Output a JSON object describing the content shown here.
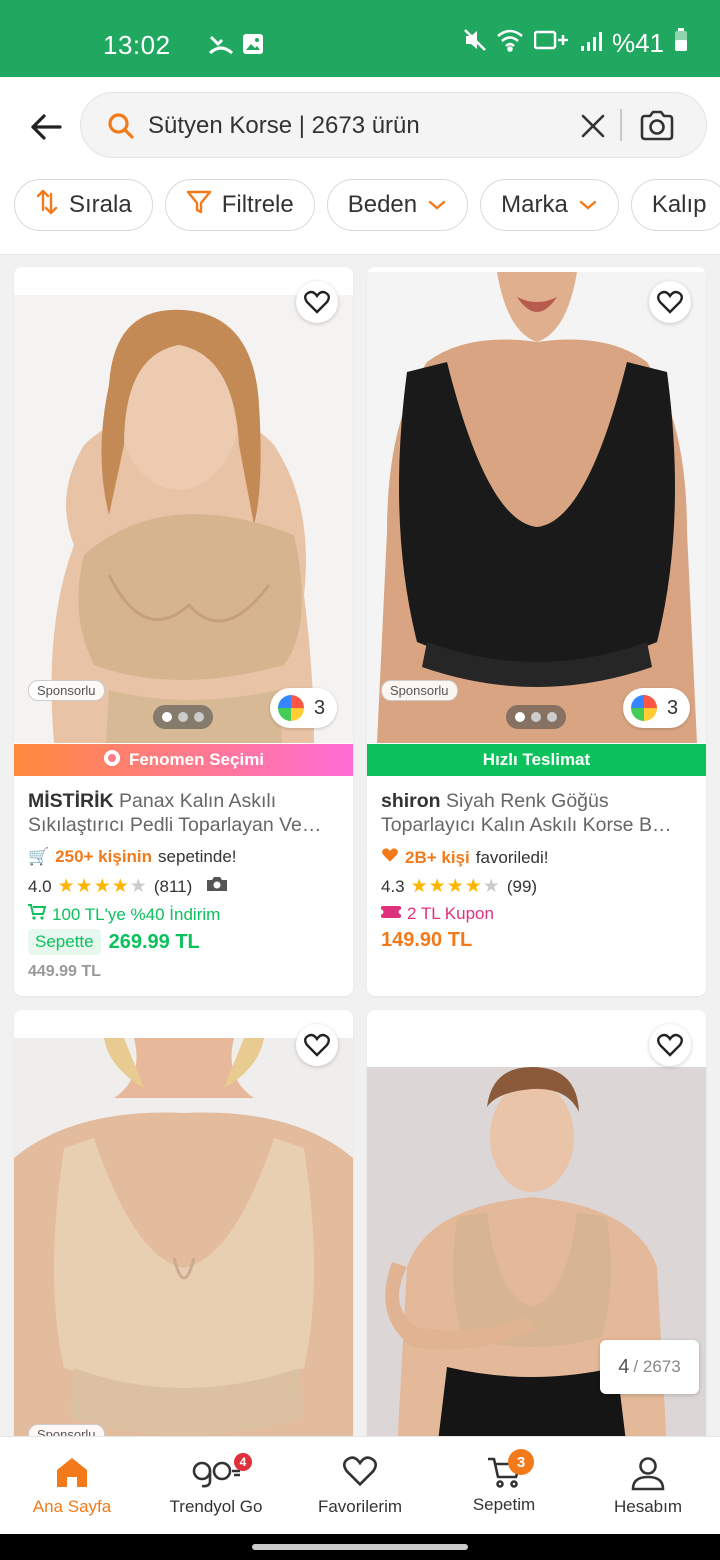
{
  "status_bar": {
    "time": "13:02",
    "battery": "%41"
  },
  "search": {
    "query": "Sütyen Korse | 2673 ürün"
  },
  "chips": [
    "Sırala",
    "Filtrele",
    "Beden",
    "Marka",
    "Kalıp"
  ],
  "products": [
    {
      "sponsor": "Sponsorlu",
      "color_count": "3",
      "banner": "Fenomen Seçimi",
      "brand": "MİSTİRİK",
      "name": "Panax Kalın Askılı Sıkılaştırıcı Pedli Toparlayan Ve…",
      "social_highlight": "250+ kişinin",
      "social_rest": "sepetinde!",
      "rating": "4.0",
      "review_count": "(811)",
      "promo": "100 TL'ye %40 İndirim",
      "basket_label": "Sepette",
      "basket_price": "269.99 TL",
      "old_price": "449.99 TL"
    },
    {
      "sponsor": "Sponsorlu",
      "color_count": "3",
      "banner": "Hızlı Teslimat",
      "brand": "shiron",
      "name": "Siyah Renk Göğüs Toparlayıcı Kalın Askılı Korse B…",
      "social_highlight": "2B+ kişi",
      "social_rest": "favoriledi!",
      "rating": "4.3",
      "review_count": "(99)",
      "coupon": "2 TL Kupon",
      "price": "149.90 TL"
    },
    {
      "sponsor": "Sponsorlu"
    },
    {}
  ],
  "pager": {
    "current": "4",
    "total": "/ 2673"
  },
  "bottom_nav": [
    {
      "label": "Ana Sayfa"
    },
    {
      "label": "Trendyol Go",
      "badge": "4"
    },
    {
      "label": "Favorilerim"
    },
    {
      "label": "Sepetim",
      "badge": "3"
    },
    {
      "label": "Hesabım"
    }
  ],
  "colors": {
    "brand_orange": "#f27a1a",
    "status_green": "#21a860",
    "fast_delivery": "#0bc15c"
  }
}
